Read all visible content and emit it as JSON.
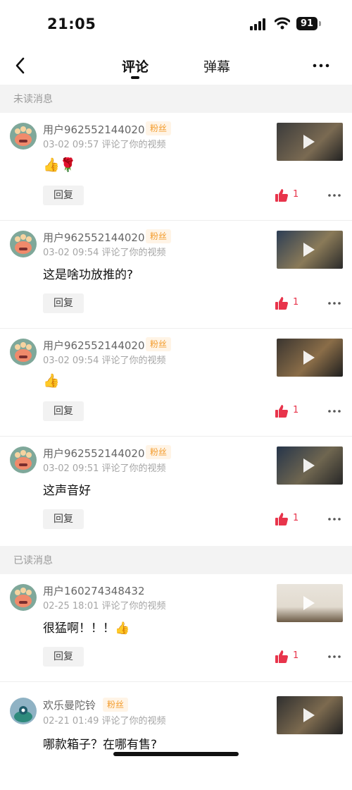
{
  "status": {
    "time": "21:05",
    "battery": "91"
  },
  "nav": {
    "tab_comments": "评论",
    "tab_danmaku": "弹幕"
  },
  "sections": {
    "unread": "未读消息",
    "read": "已读消息"
  },
  "common": {
    "fan_badge": "粉丝",
    "reply_label": "回复"
  },
  "items": [
    {
      "user": "用户962552144020",
      "fan": true,
      "time": "03-02 09:57",
      "action": "评论了你的视频",
      "content": "👍🌹",
      "likes": "1"
    },
    {
      "user": "用户962552144020",
      "fan": true,
      "time": "03-02 09:54",
      "action": "评论了你的视频",
      "content": "这是啥功放推的?",
      "likes": "1"
    },
    {
      "user": "用户962552144020",
      "fan": true,
      "time": "03-02 09:54",
      "action": "评论了你的视频",
      "content": "👍",
      "likes": "1"
    },
    {
      "user": "用户962552144020",
      "fan": true,
      "time": "03-02 09:51",
      "action": "评论了你的视频",
      "content": "这声音好",
      "likes": "1"
    },
    {
      "user": "用户160274348432",
      "fan": false,
      "time": "02-25 18:01",
      "action": "评论了你的视频",
      "content": "很猛啊！！！👍",
      "likes": "1"
    },
    {
      "user": "欢乐曼陀铃",
      "fan": true,
      "time": "02-21 01:49",
      "action": "评论了你的视频",
      "content": "哪款箱子？在哪有售?",
      "likes": ""
    }
  ]
}
